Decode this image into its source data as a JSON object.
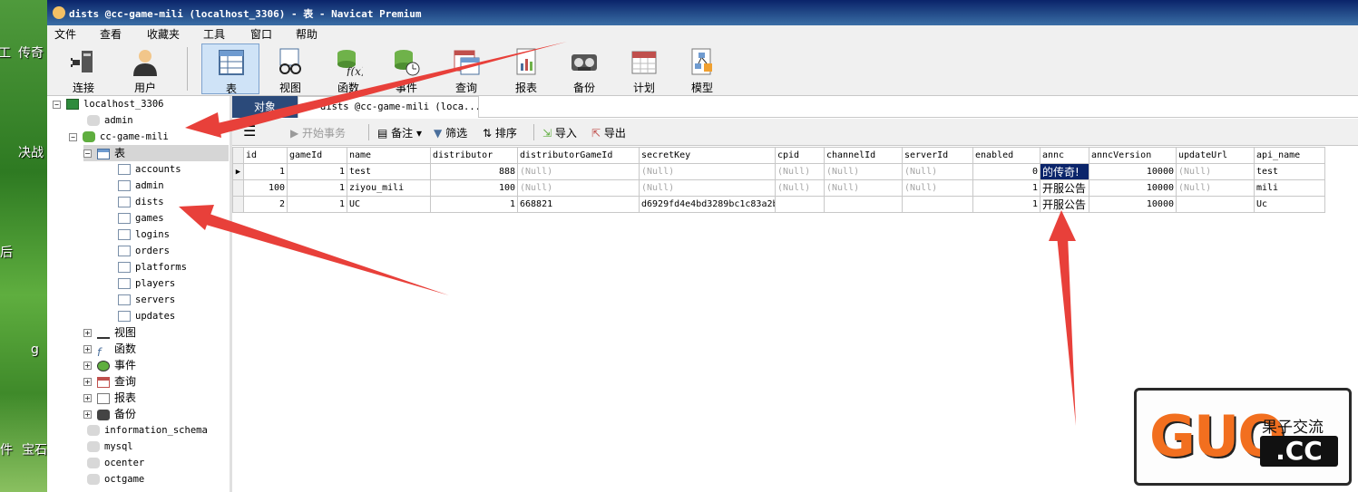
{
  "window": {
    "title": "dists @cc-game-mili (localhost_3306) - 表 - Navicat Premium"
  },
  "desktop": {
    "labels": [
      "工",
      "传奇",
      "决战",
      "后",
      "g",
      "件",
      "宝石"
    ]
  },
  "menu": [
    "文件",
    "查看",
    "收藏夹",
    "工具",
    "窗口",
    "帮助"
  ],
  "toolbar": {
    "buttons": [
      {
        "label": "连接",
        "icon": "plug-icon"
      },
      {
        "label": "用户",
        "icon": "user-icon"
      },
      {
        "label": "表",
        "icon": "table-icon"
      },
      {
        "label": "视图",
        "icon": "glasses-icon"
      },
      {
        "label": "函数",
        "icon": "function-icon"
      },
      {
        "label": "事件",
        "icon": "event-clock-icon"
      },
      {
        "label": "查询",
        "icon": "query-icon"
      },
      {
        "label": "报表",
        "icon": "report-icon"
      },
      {
        "label": "备份",
        "icon": "backup-icon"
      },
      {
        "label": "计划",
        "icon": "calendar-icon"
      },
      {
        "label": "模型",
        "icon": "model-icon"
      }
    ]
  },
  "tree": {
    "connection": "localhost_3306",
    "databases_top": [
      "admin",
      "cc-game-mili"
    ],
    "tables_group": "表",
    "tables": [
      "accounts",
      "admin",
      "dists",
      "games",
      "logins",
      "orders",
      "platforms",
      "players",
      "servers",
      "updates"
    ],
    "groups": [
      "视图",
      "函数",
      "事件",
      "查询",
      "报表",
      "备份"
    ],
    "databases_bottom": [
      "information_schema",
      "mysql",
      "ocenter",
      "octgame"
    ]
  },
  "tabs": {
    "objects": "对象",
    "dists": "dists @cc-game-mili (loca..."
  },
  "gridbar": {
    "begin_tx": "开始事务",
    "memo": "备注",
    "filter": "筛选",
    "sort": "排序",
    "import": "导入",
    "export": "导出"
  },
  "table": {
    "columns": [
      "id",
      "gameId",
      "name",
      "distributor",
      "distributorGameId",
      "secretKey",
      "cpid",
      "channelId",
      "serverId",
      "enabled",
      "annc",
      "anncVersion",
      "updateUrl",
      "api_name"
    ],
    "rows": [
      [
        "1",
        "1",
        "test",
        "888",
        "(Null)",
        "(Null)",
        "(Null)",
        "(Null)",
        "(Null)",
        "0",
        "的传奇!",
        "10000",
        "(Null)",
        "test"
      ],
      [
        "100",
        "1",
        "ziyou_mili",
        "100",
        "(Null)",
        "(Null)",
        "(Null)",
        "(Null)",
        "(Null)",
        "1",
        "开服公告",
        "10000",
        "(Null)",
        "mili"
      ],
      [
        "2",
        "1",
        "UC",
        "1",
        "668821",
        "d6929fd4e4bd3289bc1c83a2b",
        "",
        "",
        "",
        "1",
        "开服公告",
        "10000",
        "",
        "Uc"
      ]
    ]
  },
  "watermark": {
    "brand": "GUO",
    "tagline": "果子交流",
    "domain": ".CC"
  },
  "colors": {
    "titlebar": "#0a246a",
    "arrow": "#e8403a",
    "watermark_orange": "#f26f1f"
  }
}
